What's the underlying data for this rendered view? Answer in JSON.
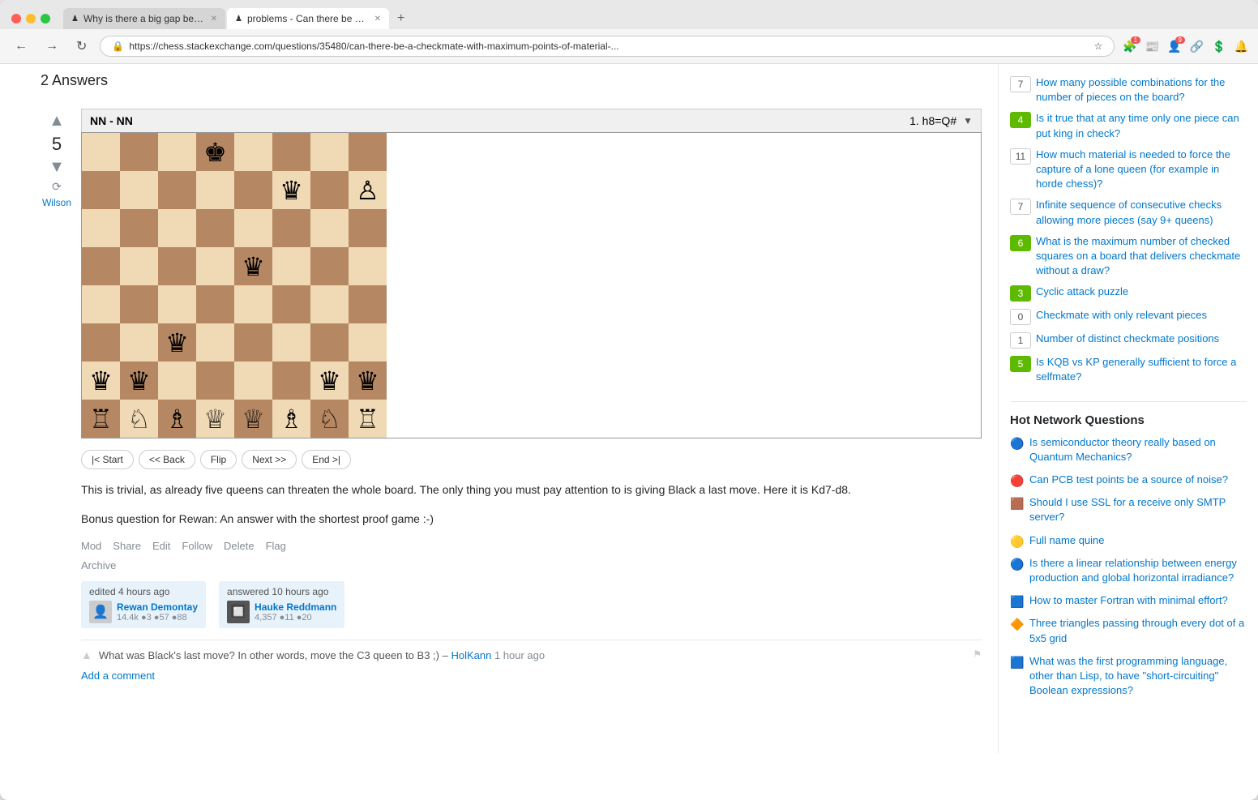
{
  "browser": {
    "tabs": [
      {
        "id": "tab1",
        "favicon": "♟",
        "title": "Why is there a big gap between...",
        "active": false
      },
      {
        "id": "tab2",
        "favicon": "♟",
        "title": "problems - Can there be a chec...",
        "active": true
      }
    ],
    "new_tab_label": "+",
    "nav": {
      "back": "←",
      "forward": "→",
      "refresh": "↻",
      "url": "https://chess.stackexchange.com/questions/35480/can-there-be-a-checkmate-with-maximum-points-of-material-...",
      "bookmark_icon": "☆",
      "menu_icon": "⋮"
    }
  },
  "page": {
    "answers_header": "2 Answers",
    "answer": {
      "vote_count": "5",
      "vote_up_label": "▲",
      "vote_down_label": "▼",
      "history_icon": "⟳",
      "answerer": "Wilson",
      "chess_title": "NN - NN",
      "move_text": "1. h8=Q#",
      "board_buttons": [
        "|< Start",
        "<< Back",
        "Flip",
        "Next >>",
        "End >|"
      ],
      "answer_text_1": "This is trivial, as already five queens can threaten the whole board. The only thing you must pay attention to is giving Black a last move. Here it is Kd7-d8.",
      "answer_text_2": "Bonus question for Rewan: An answer with the shortest proof game :-)",
      "post_actions": [
        "Mod",
        "Share",
        "Edit",
        "Follow",
        "Delete",
        "Flag"
      ],
      "archive_label": "Archive",
      "edit_info": "edited 4 hours ago",
      "editor": {
        "name": "Rewan Demontay",
        "rep": "14.4k",
        "gold": "3",
        "silver": "57",
        "bronze": "88",
        "avatar": "👤"
      },
      "answer_info": "answered 10 hours ago",
      "answerer_card": {
        "name": "Hauke Reddmann",
        "rep": "4,357",
        "gold": "11",
        "silver": "20",
        "avatar": "🔲"
      },
      "comment": {
        "text": "What was Black's last move? In other words, move the C3 queen to B3 ;) –",
        "author": "HolKann",
        "time": "1 hour ago"
      },
      "add_comment_label": "Add a comment"
    }
  },
  "sidebar": {
    "related_items": [
      {
        "score": "7",
        "answered": false,
        "text": "How many possible combinations for the number of pieces on the board?"
      },
      {
        "score": "4",
        "answered": true,
        "text": "Is it true that at any time only one piece can put king in check?"
      },
      {
        "score": "11",
        "answered": false,
        "text": "How much material is needed to force the capture of a lone queen (for example in horde chess)?"
      },
      {
        "score": "7",
        "answered": false,
        "text": "Infinite sequence of consecutive checks allowing more pieces (say 9+ queens)"
      },
      {
        "score": "6",
        "answered": true,
        "text": "What is the maximum number of checked squares on a board that delivers checkmate without a draw?"
      },
      {
        "score": "3",
        "answered": true,
        "text": "Cyclic attack puzzle"
      },
      {
        "score": "0",
        "answered": false,
        "text": "Checkmate with only relevant pieces"
      },
      {
        "score": "1",
        "answered": false,
        "text": "Number of distinct checkmate positions"
      },
      {
        "score": "5",
        "answered": true,
        "text": "Is KQB vs KP generally sufficient to force a selfmate?"
      }
    ],
    "hot_network_title": "Hot Network Questions",
    "hot_items": [
      {
        "icon": "🔵",
        "text": "Is semiconductor theory really based on Quantum Mechanics?"
      },
      {
        "icon": "🔴",
        "text": "Can PCB test points be a source of noise?"
      },
      {
        "icon": "🟫",
        "text": "Should I use SSL for a receive only SMTP server?"
      },
      {
        "icon": "🟡",
        "text": "Full name quine"
      },
      {
        "icon": "🔵",
        "text": "Is there a linear relationship between energy production and global horizontal irradiance?"
      },
      {
        "icon": "🟦",
        "text": "How to master Fortran with minimal effort?"
      },
      {
        "icon": "🔶",
        "text": "Three triangles passing through every dot of a 5x5 grid"
      },
      {
        "icon": "🟦",
        "text": "What was the first programming language, other than Lisp, to have \"short-circuiting\" Boolean expressions?"
      }
    ]
  },
  "chess_board": {
    "pieces": {
      "a8": "",
      "b8": "",
      "c8": "",
      "d8": "♚",
      "e8": "",
      "f8": "",
      "g8": "",
      "h8": "",
      "a7": "",
      "b7": "",
      "c7": "",
      "d7": "",
      "e7": "",
      "f7": "♛",
      "g7": "",
      "h7": "♙",
      "a6": "",
      "b6": "",
      "c6": "",
      "d6": "",
      "e6": "",
      "f6": "",
      "g6": "",
      "h6": "",
      "a5": "",
      "b5": "",
      "c5": "",
      "d5": "",
      "e5": "♛",
      "f5": "",
      "g5": "",
      "h5": "",
      "a4": "",
      "b4": "",
      "c4": "",
      "d4": "",
      "e4": "",
      "f4": "",
      "g4": "",
      "h4": "",
      "a3": "",
      "b3": "",
      "c3": "♛",
      "d3": "",
      "e3": "",
      "f3": "",
      "g3": "",
      "h3": "",
      "a2": "♛",
      "b2": "♛",
      "c2": "",
      "d2": "",
      "e2": "",
      "f2": "",
      "g2": "♛",
      "h2": "♛",
      "a1": "♖",
      "b1": "♘",
      "c1": "♗",
      "d1": "♕",
      "e1": "♕",
      "f1": "♗",
      "g1": "♘",
      "h1": "♖"
    }
  }
}
